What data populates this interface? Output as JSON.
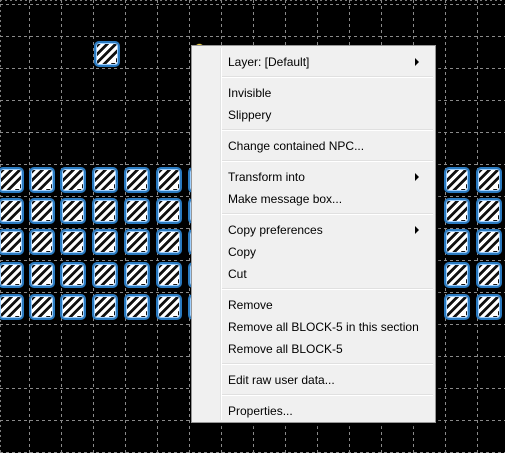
{
  "canvas": {
    "background": "#000000",
    "grid_color": "#8a8a8a",
    "block_color": "#2a7ac0",
    "tile_name": "BLOCK-5"
  },
  "context_menu": {
    "items": [
      {
        "label": "Layer: [Default]",
        "submenu": true
      },
      {
        "label": "Invisible",
        "submenu": false
      },
      {
        "label": "Slippery",
        "submenu": false
      },
      {
        "label": "Change contained NPC...",
        "submenu": false
      },
      {
        "label": "Transform into",
        "submenu": true
      },
      {
        "label": "Make message box...",
        "submenu": false
      },
      {
        "label": "Copy preferences",
        "submenu": true
      },
      {
        "label": "Copy",
        "submenu": false
      },
      {
        "label": "Cut",
        "submenu": false
      },
      {
        "label": "Remove",
        "submenu": false
      },
      {
        "label": "Remove all BLOCK-5 in this section",
        "submenu": false
      },
      {
        "label": "Remove all BLOCK-5",
        "submenu": false
      },
      {
        "label": "Edit raw user data...",
        "submenu": false
      },
      {
        "label": "Properties...",
        "submenu": false
      }
    ]
  }
}
